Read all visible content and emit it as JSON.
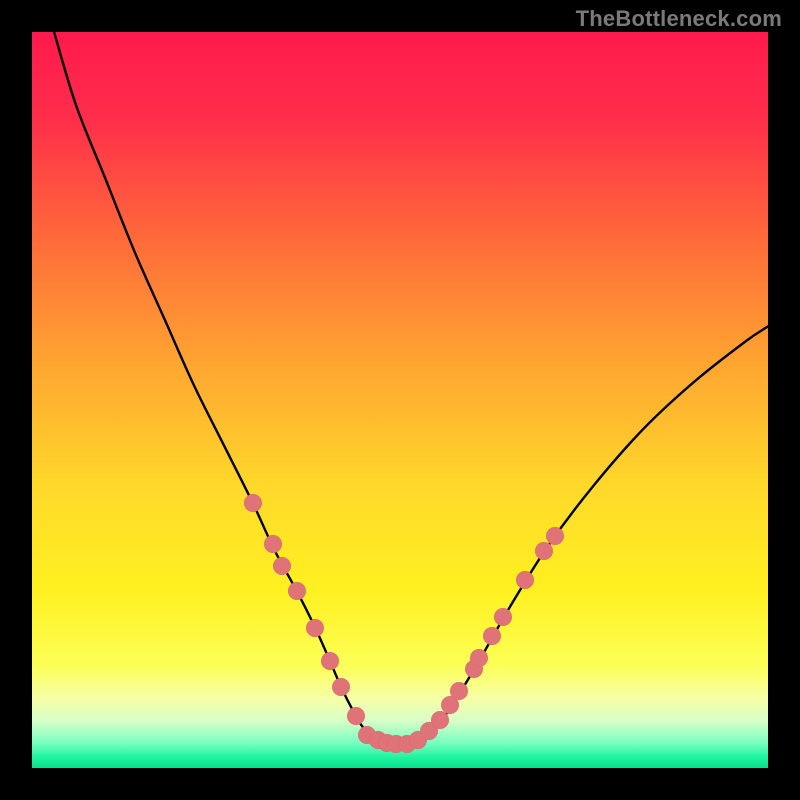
{
  "watermark": {
    "text": "TheBottleneck.com"
  },
  "colors": {
    "frame": "#000000",
    "marker": "#df7378",
    "curve": "#000000",
    "gradient_stops": [
      {
        "offset": 0.0,
        "color": "#ff1a4d"
      },
      {
        "offset": 0.12,
        "color": "#ff2e4a"
      },
      {
        "offset": 0.28,
        "color": "#ff6a3a"
      },
      {
        "offset": 0.45,
        "color": "#ffa531"
      },
      {
        "offset": 0.62,
        "color": "#ffd92a"
      },
      {
        "offset": 0.76,
        "color": "#fff121"
      },
      {
        "offset": 0.86,
        "color": "#fcff56"
      },
      {
        "offset": 0.905,
        "color": "#f6ffa6"
      },
      {
        "offset": 0.935,
        "color": "#d9ffc7"
      },
      {
        "offset": 0.965,
        "color": "#7dffc2"
      },
      {
        "offset": 0.985,
        "color": "#1ef5a0"
      },
      {
        "offset": 1.0,
        "color": "#05e08c"
      }
    ]
  },
  "chart_data": {
    "type": "line",
    "title": "",
    "xlabel": "",
    "ylabel": "",
    "xlim": [
      0,
      100
    ],
    "ylim": [
      0,
      100
    ],
    "grid": false,
    "series": [
      {
        "name": "bottleneck-curve",
        "x": [
          3,
          6,
          10,
          14,
          18,
          22,
          26,
          30,
          33,
          36,
          38.5,
          40.5,
          42,
          43.5,
          45,
          47,
          49,
          51,
          53,
          55.5,
          58,
          61,
          65,
          70,
          76,
          83,
          90,
          97,
          100
        ],
        "y": [
          100,
          90,
          80,
          70,
          61,
          52,
          44,
          36,
          29.5,
          24,
          19,
          14.5,
          11,
          8,
          5.5,
          4,
          3.3,
          3.3,
          4.2,
          6.3,
          10,
          15,
          22,
          30,
          38,
          46,
          52.5,
          58,
          60
        ]
      }
    ],
    "markers": {
      "name": "highlight-points",
      "points": [
        {
          "x": 30.0,
          "y": 36.0
        },
        {
          "x": 32.8,
          "y": 30.5
        },
        {
          "x": 34.0,
          "y": 27.5
        },
        {
          "x": 36.0,
          "y": 24.0
        },
        {
          "x": 38.5,
          "y": 19.0
        },
        {
          "x": 40.5,
          "y": 14.5
        },
        {
          "x": 42.0,
          "y": 11.0
        },
        {
          "x": 44.0,
          "y": 7.0
        },
        {
          "x": 45.5,
          "y": 4.5
        },
        {
          "x": 47.0,
          "y": 3.8
        },
        {
          "x": 48.3,
          "y": 3.4
        },
        {
          "x": 49.5,
          "y": 3.3
        },
        {
          "x": 51.0,
          "y": 3.3
        },
        {
          "x": 52.5,
          "y": 3.8
        },
        {
          "x": 54.0,
          "y": 5.0
        },
        {
          "x": 55.5,
          "y": 6.5
        },
        {
          "x": 56.8,
          "y": 8.5
        },
        {
          "x": 58.0,
          "y": 10.5
        },
        {
          "x": 60.0,
          "y": 13.5
        },
        {
          "x": 60.8,
          "y": 15.0
        },
        {
          "x": 62.5,
          "y": 18.0
        },
        {
          "x": 64.0,
          "y": 20.5
        },
        {
          "x": 67.0,
          "y": 25.5
        },
        {
          "x": 69.5,
          "y": 29.5
        },
        {
          "x": 71.0,
          "y": 31.5
        }
      ]
    }
  }
}
